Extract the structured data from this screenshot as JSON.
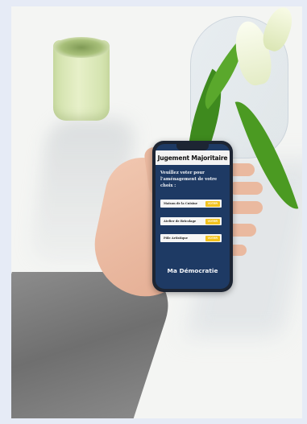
{
  "app": {
    "title": "Jugement Majoritaire",
    "prompt": "Veuillez voter pour l'aménagement de votre choix :",
    "footer_title": "Ma Démocratie"
  },
  "choices": [
    {
      "label": "Maison de la Cuisine",
      "button": "VOTER"
    },
    {
      "label": "Atelier de Bricolage",
      "button": "VOTER"
    },
    {
      "label": "Pôle Artistique",
      "button": "VOTER"
    }
  ],
  "colors": {
    "screen_bg": "#1e3a64",
    "button": "#f2c21d",
    "header_bg": "#f3f3f3"
  }
}
